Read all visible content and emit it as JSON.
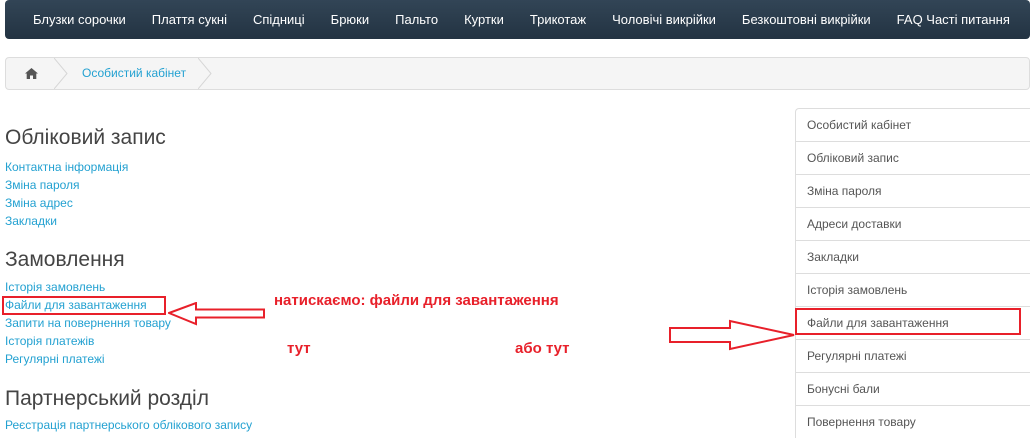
{
  "nav": {
    "items": [
      "Блузки сорочки",
      "Плаття сукні",
      "Спідниці",
      "Брюки",
      "Пальто",
      "Куртки",
      "Трикотаж",
      "Чоловічі викрійки",
      "Безкоштовні викрійки",
      "FAQ Часті питання"
    ]
  },
  "breadcrumb": {
    "home_icon": "home-icon",
    "current": "Особистий кабінет"
  },
  "account": {
    "title": "Обліковий запис",
    "links": [
      "Контактна інформація",
      "Зміна пароля",
      "Зміна адрес",
      "Закладки"
    ]
  },
  "orders": {
    "title": "Замовлення",
    "links": [
      "Історія замовлень",
      "Файли для завантаження",
      "Запити на повернення товару",
      "Історія платежів",
      "Регулярні платежі"
    ]
  },
  "affiliate": {
    "title": "Партнерський розділ",
    "links": [
      "Реєстрація партнерського облікового запису"
    ]
  },
  "sidebar": {
    "items": [
      "Особистий кабінет",
      "Обліковий запис",
      "Зміна пароля",
      "Адреси доставки",
      "Закладки",
      "Історія замовлень",
      "Файли для завантаження",
      "Регулярні платежі",
      "Бонусні бали",
      "Повернення товару"
    ]
  },
  "annotations": {
    "instruction": "натискаємо: файли для завантаження",
    "here": "тут",
    "or_here": "або тут",
    "color": "#e8202a"
  }
}
